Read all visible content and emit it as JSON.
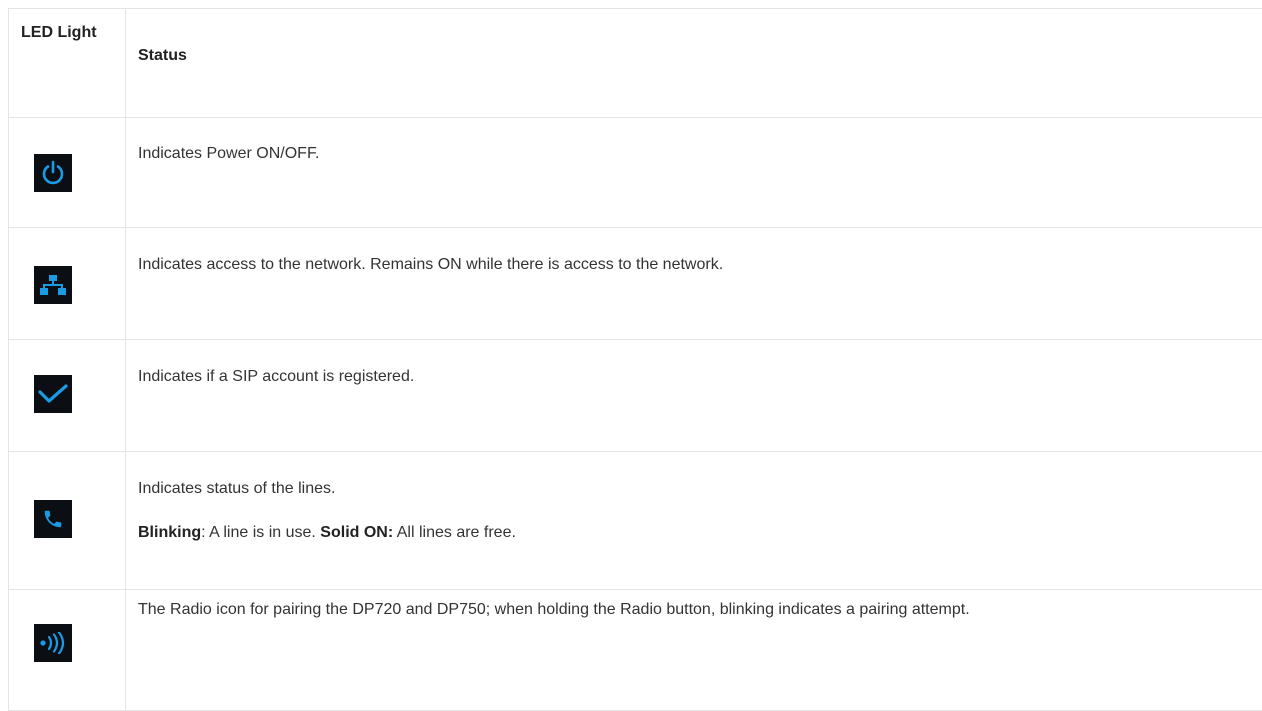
{
  "table": {
    "headers": {
      "led": "LED Light",
      "status": "Status"
    },
    "rows": [
      {
        "icon": "power-icon",
        "text": "Indicates Power ON/OFF."
      },
      {
        "icon": "network-icon",
        "text": "Indicates access to the network. Remains ON while there is access to the network."
      },
      {
        "icon": "checkmark-icon",
        "text": "Indicates if a SIP account is registered."
      },
      {
        "icon": "phone-icon",
        "text": "Indicates status of the lines.",
        "detail": {
          "blinking_label": "Blinking",
          "blinking_text": ": A line is in use. ",
          "solid_label": "Solid ON:",
          "solid_text": " All lines are free."
        }
      },
      {
        "icon": "radio-icon",
        "text": "The Radio icon for pairing the DP720 and DP750; when holding the Radio button, blinking indicates a pairing attempt."
      }
    ]
  },
  "colors": {
    "icon_background": "#0b0f14",
    "icon_color": "#1a9be6",
    "border": "#e4e4e4",
    "text": "#333333"
  }
}
